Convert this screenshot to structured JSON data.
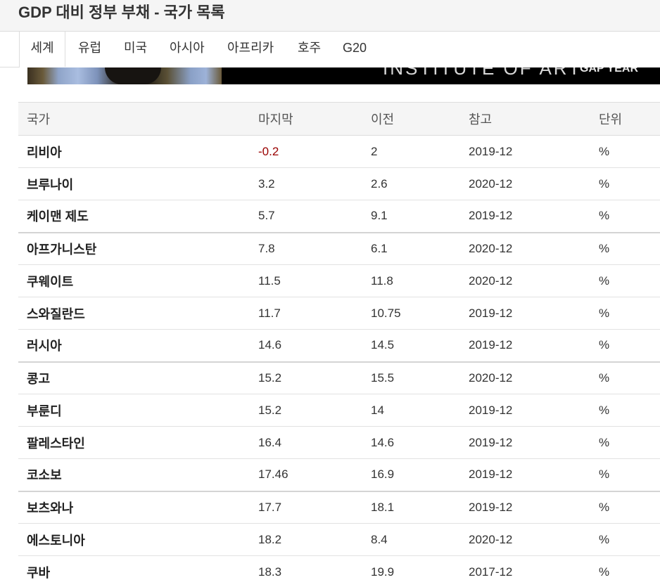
{
  "page": {
    "title": "GDP 대비 정부 부채 - 국가 목록"
  },
  "tabs": [
    {
      "label": "세계",
      "active": true
    },
    {
      "label": "유럽",
      "active": false
    },
    {
      "label": "미국",
      "active": false
    },
    {
      "label": "아시아",
      "active": false
    },
    {
      "label": "아프리카",
      "active": false
    },
    {
      "label": "호주",
      "active": false
    },
    {
      "label": "G20",
      "active": false
    }
  ],
  "banner": {
    "text_a": "INSTITUTE OF ART",
    "text_b": "GAP YEAR"
  },
  "table": {
    "headers": {
      "country": "국가",
      "last": "마지막",
      "previous": "이전",
      "reference": "참고",
      "unit": "단위"
    },
    "rows": [
      {
        "country": "리비아",
        "last": "-0.2",
        "previous": "2",
        "reference": "2019-12",
        "unit": "%"
      },
      {
        "country": "브루나이",
        "last": "3.2",
        "previous": "2.6",
        "reference": "2020-12",
        "unit": "%"
      },
      {
        "country": "케이맨 제도",
        "last": "5.7",
        "previous": "9.1",
        "reference": "2019-12",
        "unit": "%"
      },
      {
        "country": "아프가니스탄",
        "last": "7.8",
        "previous": "6.1",
        "reference": "2020-12",
        "unit": "%"
      },
      {
        "country": "쿠웨이트",
        "last": "11.5",
        "previous": "11.8",
        "reference": "2020-12",
        "unit": "%"
      },
      {
        "country": "스와질란드",
        "last": "11.7",
        "previous": "10.75",
        "reference": "2019-12",
        "unit": "%"
      },
      {
        "country": "러시아",
        "last": "14.6",
        "previous": "14.5",
        "reference": "2019-12",
        "unit": "%"
      },
      {
        "country": "콩고",
        "last": "15.2",
        "previous": "15.5",
        "reference": "2020-12",
        "unit": "%"
      },
      {
        "country": "부룬디",
        "last": "15.2",
        "previous": "14",
        "reference": "2019-12",
        "unit": "%"
      },
      {
        "country": "팔레스타인",
        "last": "16.4",
        "previous": "14.6",
        "reference": "2019-12",
        "unit": "%"
      },
      {
        "country": "코소보",
        "last": "17.46",
        "previous": "16.9",
        "reference": "2019-12",
        "unit": "%"
      },
      {
        "country": "보츠와나",
        "last": "17.7",
        "previous": "18.1",
        "reference": "2019-12",
        "unit": "%"
      },
      {
        "country": "에스토니아",
        "last": "18.2",
        "previous": "8.4",
        "reference": "2020-12",
        "unit": "%"
      },
      {
        "country": "쿠바",
        "last": "18.3",
        "previous": "19.9",
        "reference": "2017-12",
        "unit": "%"
      }
    ]
  }
}
